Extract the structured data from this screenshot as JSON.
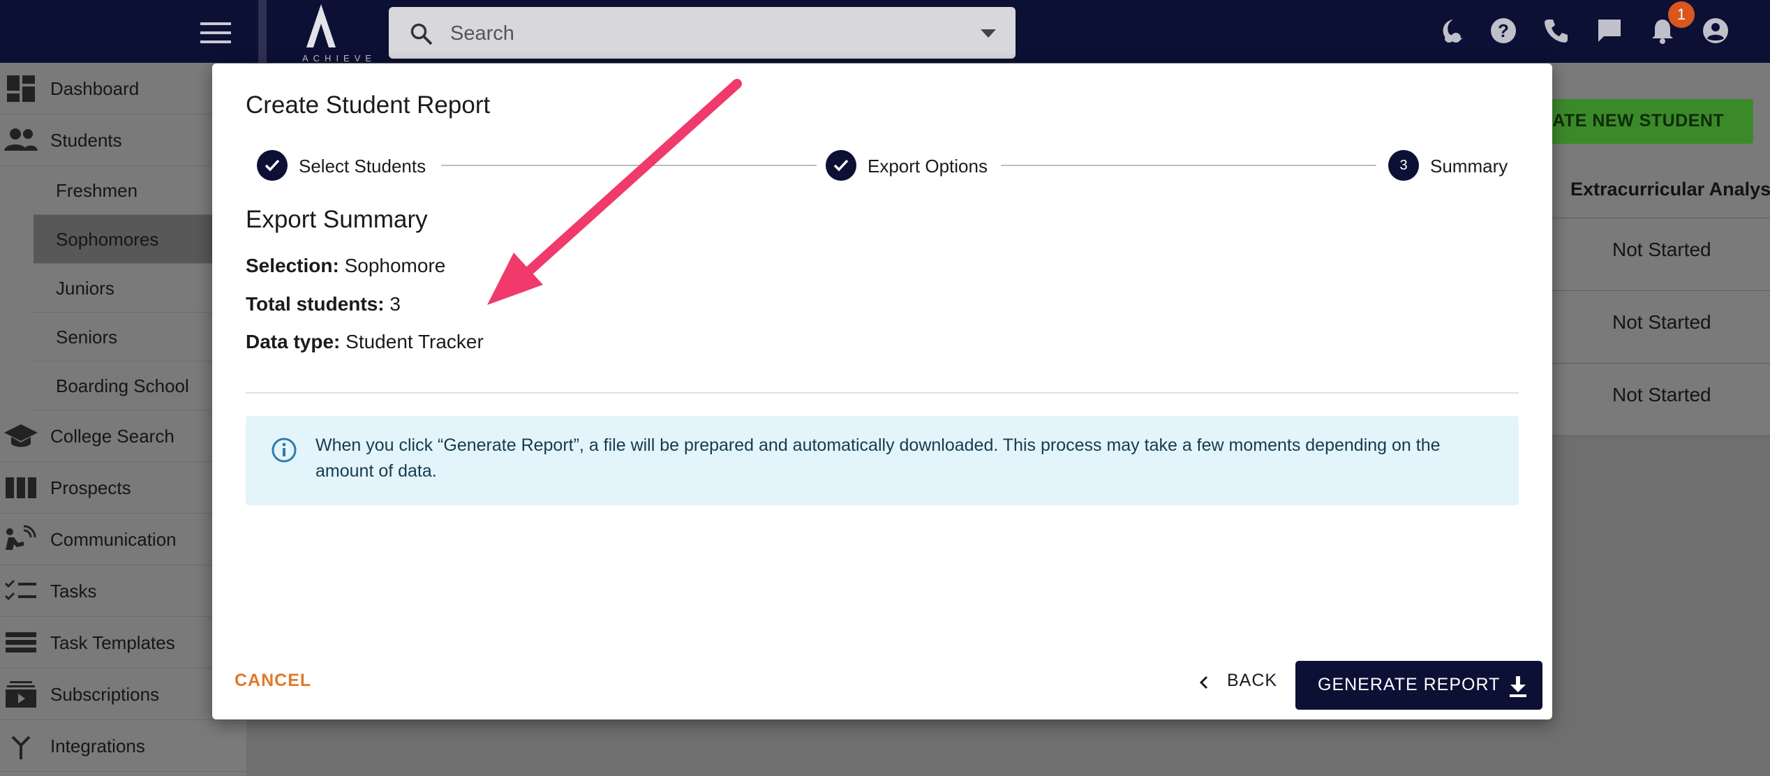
{
  "topbar": {
    "logo_text": "ACHIEVE",
    "search_placeholder": "Search",
    "notification_count": "1",
    "icons": [
      "hamburger-menu-icon",
      "moon-icon",
      "help-icon",
      "phone-icon",
      "chat-icon",
      "bell-icon",
      "account-icon"
    ],
    "background": "#0c1035",
    "badge_color": "#d9561f"
  },
  "sidebar": {
    "items": [
      {
        "label": "Dashboard",
        "icon": "dashboard-icon"
      },
      {
        "label": "Students",
        "icon": "people-icon"
      },
      {
        "label": "College Search",
        "icon": "graduation-cap-icon"
      },
      {
        "label": "Prospects",
        "icon": "columns-icon"
      },
      {
        "label": "Communication",
        "icon": "communication-icon"
      },
      {
        "label": "Tasks",
        "icon": "checklist-icon"
      },
      {
        "label": "Task Templates",
        "icon": "list-icon"
      },
      {
        "label": "Subscriptions",
        "icon": "subscriptions-icon"
      },
      {
        "label": "Integrations",
        "icon": "merge-icon"
      }
    ],
    "student_subitems": [
      "Freshmen",
      "Sophomores",
      "Juniors",
      "Seniors",
      "Boarding School"
    ],
    "active_subitem": "Sophomores"
  },
  "main": {
    "create_button_label": "CREATE NEW STUDENT",
    "column_header": "Extracurricular Analysis",
    "statuses": [
      "Not Started",
      "Not Started",
      "Not Started"
    ]
  },
  "modal": {
    "title": "Create Student Report",
    "steps": [
      {
        "label": "Select Students",
        "state": "complete",
        "number": "1"
      },
      {
        "label": "Export Options",
        "state": "complete",
        "number": "2"
      },
      {
        "label": "Summary",
        "state": "active",
        "number": "3"
      }
    ],
    "summary_heading": "Export Summary",
    "selection_label": "Selection:",
    "selection_value": "Sophomore",
    "total_label": "Total students:",
    "total_value": "3",
    "datatype_label": "Data type:",
    "datatype_value": "Student Tracker",
    "info_text": "When you click “Generate Report”, a file will be prepared and automatically downloaded. This process may take a few moments depending on the amount of data.",
    "cancel_label": "CANCEL",
    "back_label": "BACK",
    "generate_label": "GENERATE REPORT",
    "accent_color": "#e07a2a",
    "primary_color": "#0c1035",
    "info_bg": "#e4f4fb"
  },
  "annotation": {
    "arrow_color": "#ef3a6b"
  }
}
